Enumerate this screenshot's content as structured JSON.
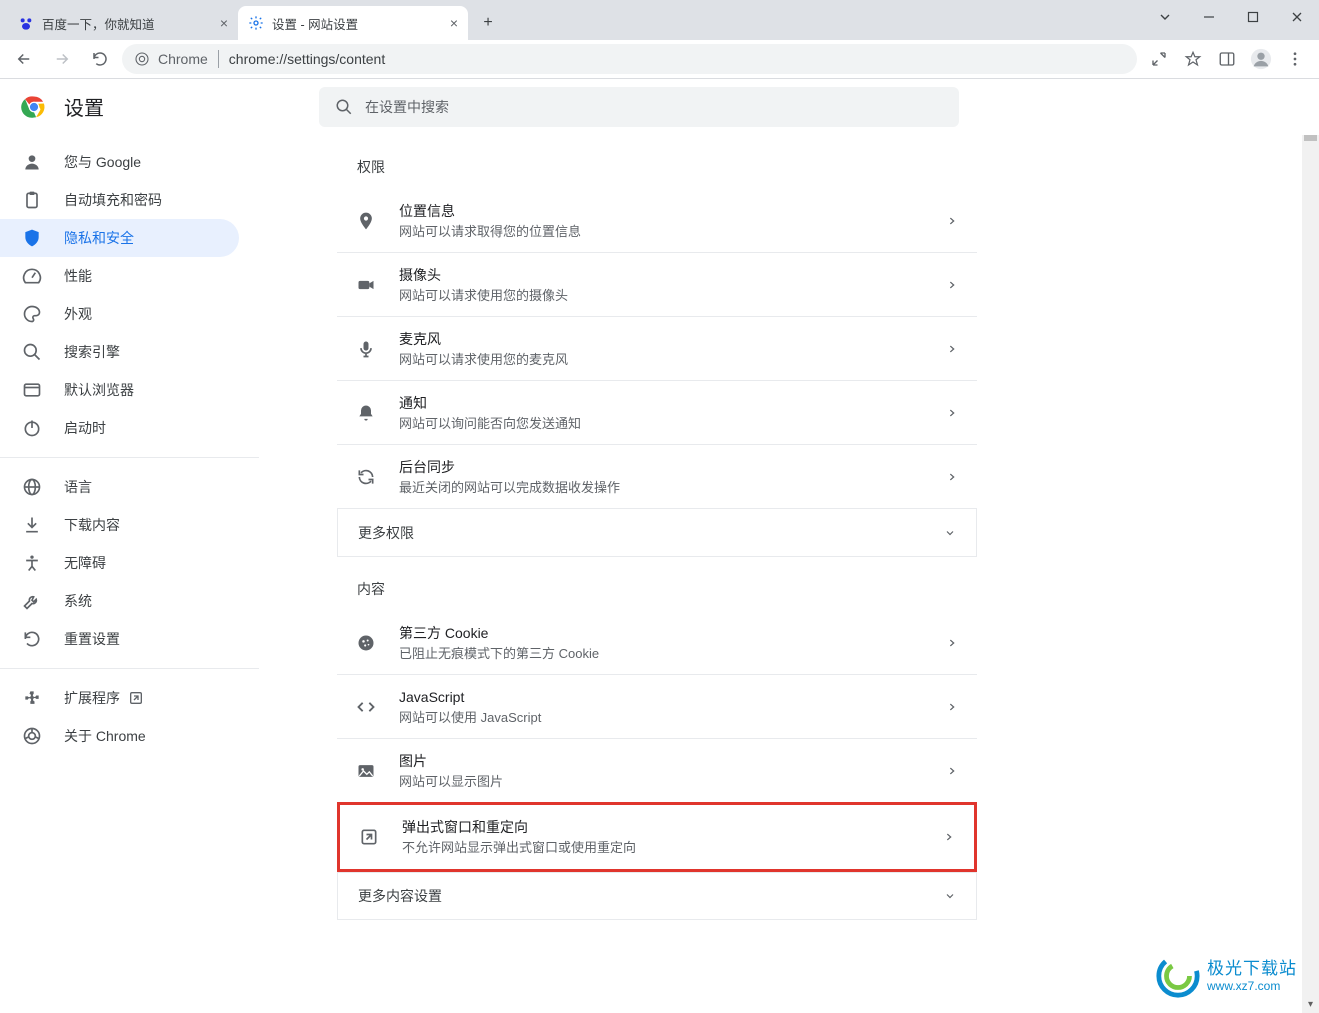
{
  "window": {
    "tabs": [
      {
        "title": "百度一下，你就知道",
        "active": false
      },
      {
        "title": "设置 - 网站设置",
        "active": true
      }
    ],
    "url_prefix": "Chrome",
    "url": "chrome://settings/content"
  },
  "header": {
    "title": "设置",
    "search_placeholder": "在设置中搜索"
  },
  "sidebar": {
    "groups": [
      [
        {
          "icon": "person",
          "label": "您与 Google"
        },
        {
          "icon": "clipboard",
          "label": "自动填充和密码"
        },
        {
          "icon": "shield",
          "label": "隐私和安全",
          "active": true
        },
        {
          "icon": "speed",
          "label": "性能"
        },
        {
          "icon": "palette",
          "label": "外观"
        },
        {
          "icon": "search",
          "label": "搜索引擎"
        },
        {
          "icon": "browser",
          "label": "默认浏览器"
        },
        {
          "icon": "power",
          "label": "启动时"
        }
      ],
      [
        {
          "icon": "globe",
          "label": "语言"
        },
        {
          "icon": "download",
          "label": "下载内容"
        },
        {
          "icon": "a11y",
          "label": "无障碍"
        },
        {
          "icon": "wrench",
          "label": "系统"
        },
        {
          "icon": "reset",
          "label": "重置设置"
        }
      ],
      [
        {
          "icon": "puzzle",
          "label": "扩展程序",
          "external": true
        },
        {
          "icon": "chrome",
          "label": "关于 Chrome"
        }
      ]
    ]
  },
  "content": {
    "section1_label": "权限",
    "perm_rows": [
      {
        "icon": "location",
        "title": "位置信息",
        "sub": "网站可以请求取得您的位置信息"
      },
      {
        "icon": "camera",
        "title": "摄像头",
        "sub": "网站可以请求使用您的摄像头"
      },
      {
        "icon": "mic",
        "title": "麦克风",
        "sub": "网站可以请求使用您的麦克风"
      },
      {
        "icon": "bell",
        "title": "通知",
        "sub": "网站可以询问能否向您发送通知"
      },
      {
        "icon": "sync",
        "title": "后台同步",
        "sub": "最近关闭的网站可以完成数据收发操作"
      }
    ],
    "more_perm": "更多权限",
    "section2_label": "内容",
    "content_rows": [
      {
        "icon": "cookie",
        "title": "第三方 Cookie",
        "sub": "已阻止无痕模式下的第三方 Cookie"
      },
      {
        "icon": "code",
        "title": "JavaScript",
        "sub": "网站可以使用 JavaScript"
      },
      {
        "icon": "image",
        "title": "图片",
        "sub": "网站可以显示图片"
      }
    ],
    "popup_row": {
      "icon": "popup",
      "title": "弹出式窗口和重定向",
      "sub": "不允许网站显示弹出式窗口或使用重定向"
    },
    "more_content": "更多内容设置"
  },
  "watermark": {
    "line1": "极光下载站",
    "url": "www.xz7.com"
  }
}
